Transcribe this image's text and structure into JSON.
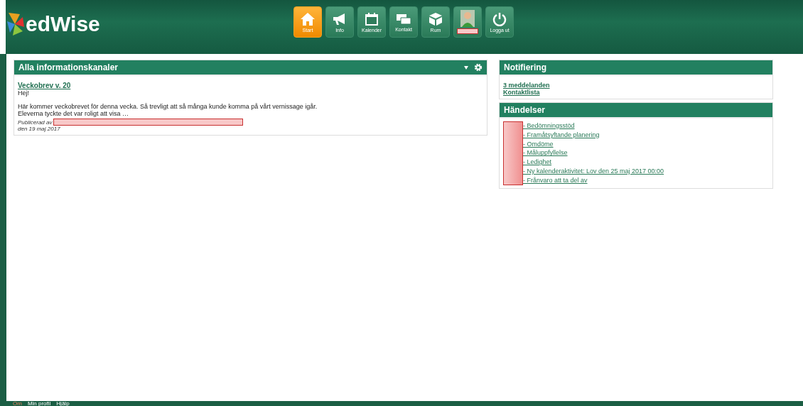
{
  "header": {
    "logo": "edWise",
    "nav": [
      {
        "kind": "home",
        "label": "Start",
        "selected": true
      },
      {
        "kind": "megaphone",
        "label": "Info",
        "selected": false
      },
      {
        "kind": "calendar",
        "label": "Kalender",
        "selected": false
      },
      {
        "kind": "mail",
        "label": "Kontakt",
        "selected": false
      },
      {
        "kind": "cube",
        "label": "Rum",
        "selected": false
      },
      {
        "kind": "profile",
        "selected": false
      },
      {
        "kind": "power",
        "label": "Logga ut",
        "selected": false
      }
    ]
  },
  "channels_panel": {
    "title": "Alla informationskanaler",
    "posts": [
      {
        "title": "Veckobrev v. 20",
        "greeting": "Hej!",
        "body": "Här kommer veckobrevet för denna vecka. Så trevligt att så många kunde komma på vårt vernissage igår. Eleverna tyckte det var roligt att visa …",
        "published_by": "Publicerad av",
        "date": "den 19 maj 2017"
      }
    ]
  },
  "notification_panel": {
    "title": "Notifiering",
    "links": [
      "3 meddelanden",
      "Kontaktlista"
    ]
  },
  "events_panel": {
    "title": "Händelser",
    "links": [
      "- Bedömningsstöd",
      "- Framåtsyftande planering",
      "- Omdöme",
      "- Måluppfyllelse",
      "- Ledighet",
      "- Ny kalenderaktivitet: Lov den 25 maj 2017 00:00",
      "- Frånvaro att ta del av"
    ]
  },
  "footer": {
    "links": [
      "Om",
      "Min profil",
      "Hjälp"
    ]
  }
}
